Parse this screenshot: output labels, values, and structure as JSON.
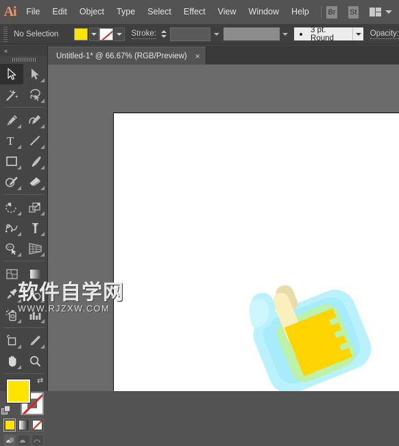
{
  "app": {
    "logo_text": "Ai",
    "title": "Adobe Illustrator"
  },
  "menubar": {
    "items": [
      {
        "label": "File"
      },
      {
        "label": "Edit"
      },
      {
        "label": "Object"
      },
      {
        "label": "Type"
      },
      {
        "label": "Select"
      },
      {
        "label": "Effect"
      },
      {
        "label": "View"
      },
      {
        "label": "Window"
      },
      {
        "label": "Help"
      }
    ],
    "bridge_button": "Br",
    "stock_button": "St",
    "workspace_icon": "workspace-switcher-icon"
  },
  "controlbar": {
    "selection_status": "No Selection",
    "fill_color": "#ffe400",
    "stroke_color": "none",
    "stroke_label": "Stroke:",
    "stroke_weight": "",
    "stroke_profile": "",
    "brush_definition": "3 pt. Round",
    "opacity_label": "Opacity:"
  },
  "tabbar": {
    "tabs": [
      {
        "title": "Untitled-1* @ 66.67% (RGB/Preview)",
        "close": "×",
        "active": true
      }
    ]
  },
  "toolpanel": {
    "collapse_label": "«",
    "tools": [
      {
        "name": "selection-tool",
        "active": true
      },
      {
        "name": "direct-selection-tool",
        "active": false
      },
      {
        "name": "magic-wand-tool",
        "active": false
      },
      {
        "name": "lasso-tool",
        "active": false
      },
      {
        "name": "pen-tool",
        "active": false
      },
      {
        "name": "curvature-tool",
        "active": false
      },
      {
        "name": "type-tool",
        "active": false
      },
      {
        "name": "line-segment-tool",
        "active": false
      },
      {
        "name": "rectangle-tool",
        "active": false
      },
      {
        "name": "paintbrush-tool",
        "active": false
      },
      {
        "name": "shaper-tool",
        "active": false
      },
      {
        "name": "eraser-tool",
        "active": false
      },
      {
        "name": "rotate-tool",
        "active": false
      },
      {
        "name": "scale-tool",
        "active": false
      },
      {
        "name": "width-tool",
        "active": false
      },
      {
        "name": "free-transform-tool",
        "active": false
      },
      {
        "name": "shape-builder-tool",
        "active": false
      },
      {
        "name": "perspective-grid-tool",
        "active": false
      },
      {
        "name": "mesh-tool",
        "active": false
      },
      {
        "name": "gradient-tool",
        "active": false
      },
      {
        "name": "eyedropper-tool",
        "active": false
      },
      {
        "name": "blend-tool",
        "active": false
      },
      {
        "name": "symbol-sprayer-tool",
        "active": false
      },
      {
        "name": "column-graph-tool",
        "active": false
      },
      {
        "name": "artboard-tool",
        "active": false
      },
      {
        "name": "slice-tool",
        "active": false
      },
      {
        "name": "hand-tool",
        "active": false
      },
      {
        "name": "zoom-tool",
        "active": false
      }
    ],
    "fill_color": "#ffe400",
    "stroke_color": "none",
    "swap_icon": "swap-fill-stroke-icon",
    "default_icon": "default-fill-stroke-icon",
    "color_modes": [
      {
        "name": "color-mode-button",
        "selected": true
      },
      {
        "name": "gradient-mode-button",
        "selected": false
      },
      {
        "name": "none-mode-button",
        "selected": false
      }
    ],
    "draw_modes": [
      {
        "name": "draw-normal-button",
        "selected": true
      },
      {
        "name": "draw-behind-button",
        "selected": false
      },
      {
        "name": "draw-inside-button",
        "selected": false
      }
    ]
  },
  "canvas": {
    "artwork_name": "baby-bottle-illustration",
    "colors": {
      "bottle_body_light": "#b3f0fb",
      "bottle_body_mid": "#a5e9f7",
      "milk_green": "#b9f0a5",
      "nipple_cream": "#f9f0bb",
      "collar_tan": "#e8dcaa",
      "measure_yellow": "#ffd400",
      "artboard": "#ffffff"
    }
  },
  "watermark": {
    "line1": "软件自学网",
    "line2": "WWW.RJZXW.COM"
  }
}
